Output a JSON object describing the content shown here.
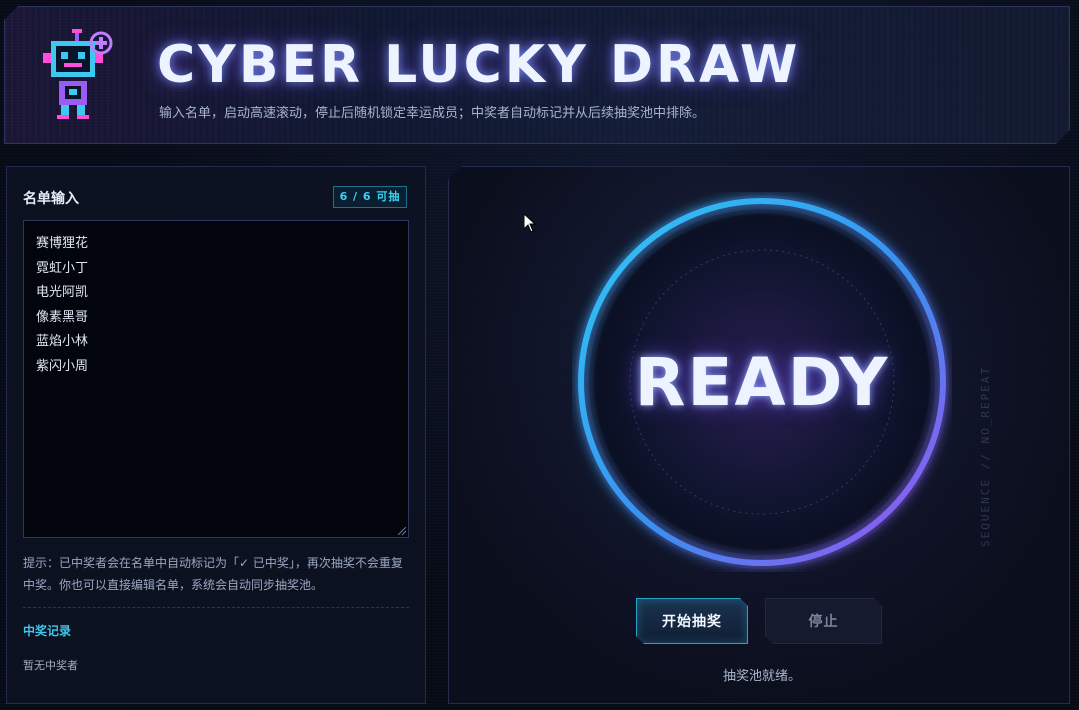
{
  "header": {
    "title": "CYBER LUCKY DRAW",
    "subtitle": "输入名单，启动高速滚动，停止后随机锁定幸运成员；中奖者自动标记并从后续抽奖池中排除。",
    "logo_icon": "robot-icon"
  },
  "left_panel": {
    "title": "名单输入",
    "count_badge": "6 / 6 可抽",
    "names": [
      "赛博狸花",
      "霓虹小丁",
      "电光阿凯",
      "像素黑哥",
      "蓝焰小林",
      "紫闪小周"
    ],
    "hint": "提示：已中奖者会在名单中自动标记为「✓ 已中奖」，再次抽奖不会重复中奖。你也可以直接编辑名单，系统会自动同步抽奖池。",
    "records_title": "中奖记录",
    "records_empty": "暂无中奖者"
  },
  "right_panel": {
    "display_text": "READY",
    "start_label": "开始抽奖",
    "stop_label": "停止",
    "status": "抽奖池就绪。",
    "vertical_text": "SEQUENCE // NO_REPEAT"
  },
  "colors": {
    "accent_cyan": "#3ed2f2",
    "accent_purple": "#8a3fe0",
    "background": "#080b16"
  }
}
